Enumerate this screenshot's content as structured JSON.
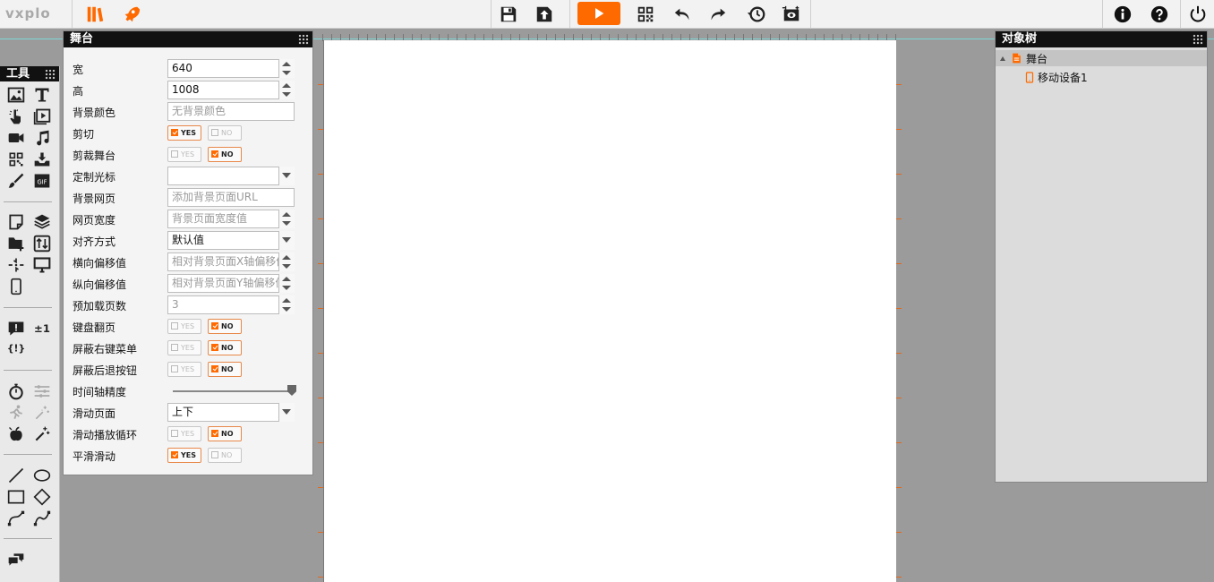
{
  "app": {
    "logo": "vxplo"
  },
  "toolbar": {
    "icons": [
      "library-icon",
      "rocket-icon",
      "save-icon",
      "publish-icon",
      "play-icon",
      "qrcode-icon",
      "undo-icon",
      "redo-icon",
      "history-icon",
      "screenshot-icon",
      "info-icon",
      "help-icon",
      "power-icon"
    ],
    "accent": "#ff6a00"
  },
  "tools_panel": {
    "title": "工具"
  },
  "stage_panel": {
    "title": "舞台",
    "fields": {
      "width": {
        "label": "宽",
        "value": "640"
      },
      "height": {
        "label": "高",
        "value": "1008"
      },
      "bg_color": {
        "label": "背景颜色",
        "placeholder": "无背景颜色"
      },
      "clip": {
        "label": "剪切",
        "yes": "YES",
        "no": "NO"
      },
      "clip_stage": {
        "label": "剪裁舞台",
        "yes": "YES",
        "no": "NO"
      },
      "cursor": {
        "label": "定制光标",
        "value": ""
      },
      "bg_page": {
        "label": "背景网页",
        "placeholder": "添加背景页面URL"
      },
      "page_width": {
        "label": "网页宽度",
        "placeholder": "背景页面宽度值"
      },
      "align": {
        "label": "对齐方式",
        "value": "默认值"
      },
      "offset_x": {
        "label": "横向偏移值",
        "placeholder": "相对背景页面X轴偏移值"
      },
      "offset_y": {
        "label": "纵向偏移值",
        "placeholder": "相对背景页面Y轴偏移值"
      },
      "preload": {
        "label": "预加载页数",
        "placeholder": "3"
      },
      "keyboard_flip": {
        "label": "键盘翻页",
        "yes": "YES",
        "no": "NO"
      },
      "block_right_menu": {
        "label": "屏蔽右键菜单",
        "yes": "YES",
        "no": "NO"
      },
      "block_back": {
        "label": "屏蔽后退按钮",
        "yes": "YES",
        "no": "NO"
      },
      "timeline_precision": {
        "label": "时间轴精度",
        "level": 1.0
      },
      "scroll_page": {
        "label": "滑动页面",
        "value": "上下"
      },
      "scroll_loop": {
        "label": "滑动播放循环",
        "yes": "YES",
        "no": "NO"
      },
      "smooth_scroll": {
        "label": "平滑滑动",
        "yes": "YES",
        "no": "NO"
      }
    }
  },
  "object_tree": {
    "title": "对象树",
    "nodes": [
      {
        "label": "舞台"
      },
      {
        "label": "移动设备1"
      }
    ]
  }
}
